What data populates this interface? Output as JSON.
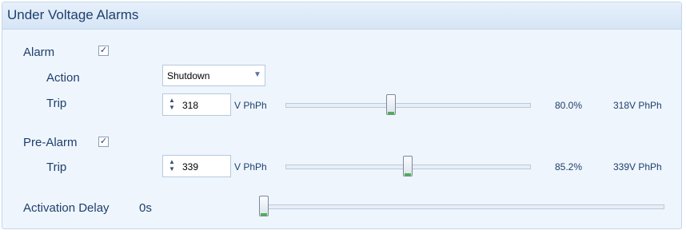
{
  "panel": {
    "title": "Under Voltage Alarms"
  },
  "alarm": {
    "label": "Alarm",
    "checked": true,
    "action_label": "Action",
    "action_value": "Shutdown",
    "trip_label": "Trip",
    "trip_value": "318",
    "trip_unit": "V PhPh",
    "slider_fraction": 0.8,
    "percent_text": "80.0%",
    "value_text": "318V PhPh"
  },
  "pre_alarm": {
    "label": "Pre-Alarm",
    "checked": true,
    "trip_label": "Trip",
    "trip_value": "339",
    "trip_unit": "V PhPh",
    "slider_fraction": 0.852,
    "percent_text": "85.2%",
    "value_text": "339V PhPh"
  },
  "activation_delay": {
    "label": "Activation Delay",
    "value_text": "0s",
    "slider_fraction": 0.0
  },
  "colors": {
    "panel_bg": "#eef5fd",
    "text": "#1f3f6c",
    "thumb_accent": "#4caf50"
  }
}
